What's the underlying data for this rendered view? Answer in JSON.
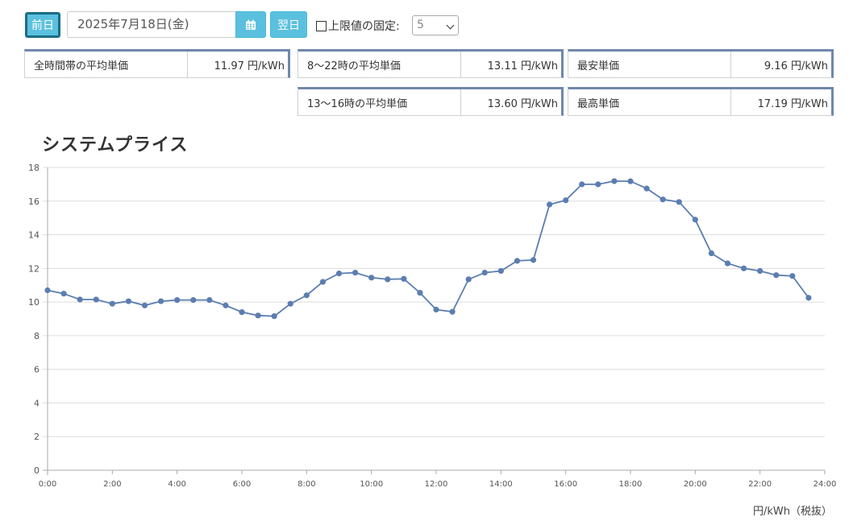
{
  "controls": {
    "prev_label": "前日",
    "date_value": "2025年7月18日(金)",
    "next_label": "翌日",
    "limit_label": "上限値の固定:",
    "limit_value": "5",
    "limit_checked": false
  },
  "stats": [
    {
      "label": "全時間帯の平均単価",
      "value": "11.97 円/kWh"
    },
    {
      "label": "8〜22時の平均単価",
      "value": "13.11 円/kWh"
    },
    {
      "label": "最安単価",
      "value": "9.16 円/kWh"
    },
    {
      "label": "13〜16時の平均単価",
      "value": "13.60 円/kWh"
    },
    {
      "label": "最高単価",
      "value": "17.19 円/kWh"
    }
  ],
  "chart_data": {
    "type": "line",
    "title": "システムプライス",
    "ylabel": "円/kWh（税抜）",
    "xlabel": "",
    "ylim": [
      0,
      18
    ],
    "xlim": [
      0,
      24
    ],
    "grid": true,
    "line_color": "#5b7db1",
    "y_ticks": [
      "0",
      "2",
      "4",
      "6",
      "8",
      "10",
      "12",
      "14",
      "16",
      "18"
    ],
    "x_ticks": [
      "0:00",
      "2:00",
      "4:00",
      "6:00",
      "8:00",
      "10:00",
      "12:00",
      "14:00",
      "16:00",
      "18:00",
      "20:00",
      "22:00",
      "24:00"
    ],
    "series": [
      {
        "x": [
          0,
          0.5,
          1,
          1.5,
          2,
          2.5,
          3,
          3.5,
          4,
          4.5,
          5,
          5.5,
          6,
          6.5,
          7,
          7.5,
          8,
          8.5,
          9,
          9.5,
          10,
          10.5,
          11,
          11.5,
          12,
          12.5,
          13,
          13.5,
          14,
          14.5,
          15,
          15.5,
          16,
          16.5,
          17,
          17.5,
          18,
          18.5,
          19,
          19.5,
          20,
          20.5,
          21,
          21.5,
          22,
          22.5,
          23,
          23.5
        ],
        "values": [
          10.7,
          10.5,
          10.15,
          10.15,
          9.9,
          10.05,
          9.8,
          10.05,
          10.12,
          10.12,
          10.12,
          9.8,
          9.4,
          9.2,
          9.16,
          9.9,
          10.4,
          11.2,
          11.7,
          11.75,
          11.45,
          11.35,
          11.38,
          10.55,
          9.55,
          9.42,
          11.35,
          11.75,
          11.85,
          12.45,
          12.5,
          15.8,
          16.05,
          17.0,
          17.0,
          17.19,
          17.18,
          16.75,
          16.1,
          15.95,
          14.9,
          12.9,
          12.3,
          12.0,
          11.85,
          11.6,
          11.55,
          10.25
        ]
      }
    ]
  }
}
